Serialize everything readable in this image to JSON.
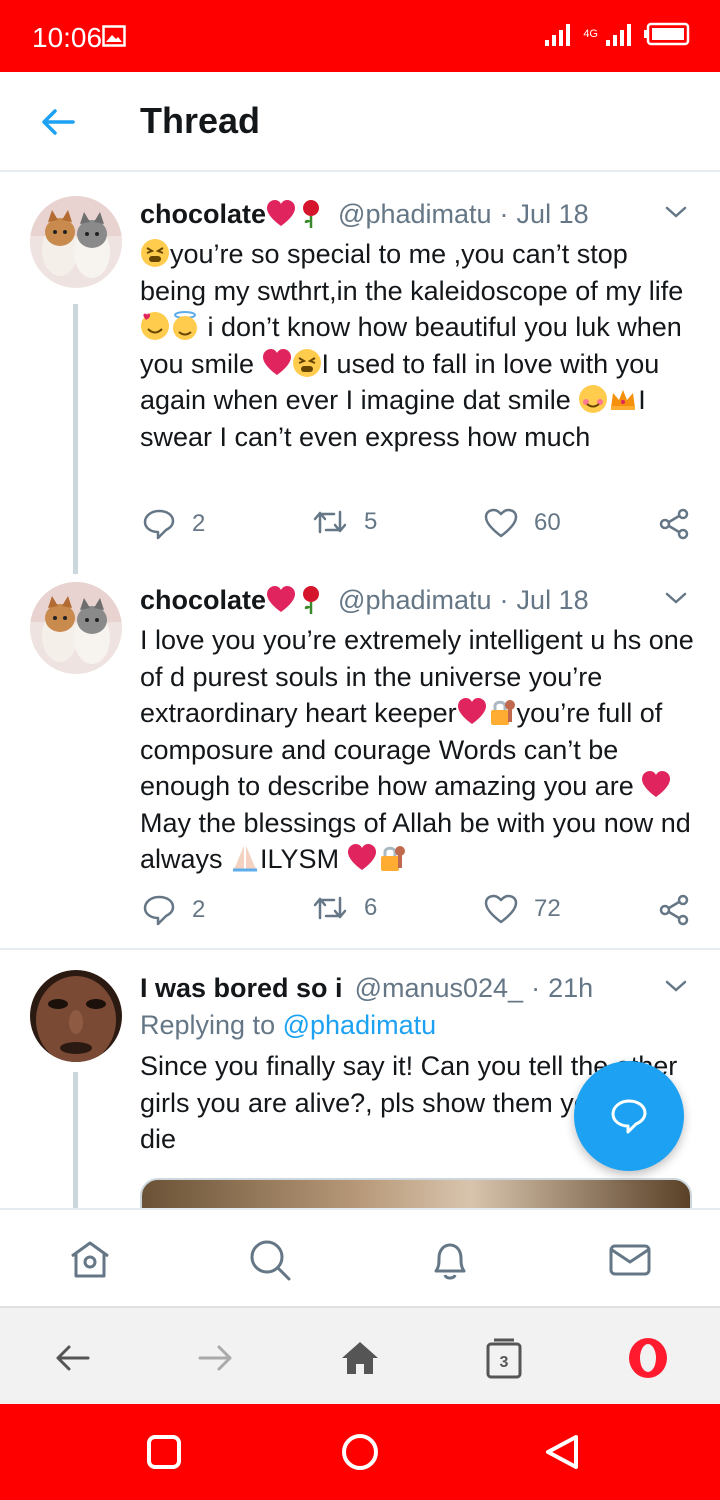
{
  "status_bar": {
    "time": "10:06",
    "network": "4G"
  },
  "header": {
    "title": "Thread"
  },
  "tweets": [
    {
      "name": "chocolate",
      "handle": "@phadimatu",
      "separator": "·",
      "date": "Jul 18",
      "text_parts": [
        "you’re so special to me ,you can’t stop being my swthrt,in the kaleidoscope of my life",
        " i don’t know how beautiful you luk when you smile ",
        "I used to fall in love with you again when ever I imagine dat smile ",
        "I swear I can’t even express how much"
      ],
      "replies": "2",
      "retweets": "5",
      "likes": "60"
    },
    {
      "name": "chocolate",
      "handle": "@phadimatu",
      "separator": "·",
      "date": "Jul 18",
      "text_parts": [
        "I love you  you’re extremely intelligent u hs one of d purest souls in the universe you’re extraordinary heart keeper",
        "you’re full of composure and courage Words can’t be enough to describe how amazing you are ",
        "May the blessings of Allah be with you now nd always ",
        "ILYSM "
      ],
      "replies": "2",
      "retweets": "6",
      "likes": "72"
    },
    {
      "name": "I was bored so i",
      "handle": "@manus024_",
      "separator": "·",
      "date": "21h",
      "replying_label": "Replying to",
      "replying_handle": "@phadimatu",
      "text": "Since you finally say it! Can you tell the other girls you are alive?, pls show them you didn't die"
    }
  ],
  "icons": {
    "reply": "reply-icon",
    "retweet": "retweet-icon",
    "like": "heart-icon",
    "share": "share-icon",
    "compose": "compose-reply-icon"
  },
  "browser": {
    "tab_count": "3"
  },
  "colors": {
    "accent": "#1da1f2",
    "status_bar": "#ff0000",
    "muted": "#657786",
    "heart": "#e0245e"
  }
}
